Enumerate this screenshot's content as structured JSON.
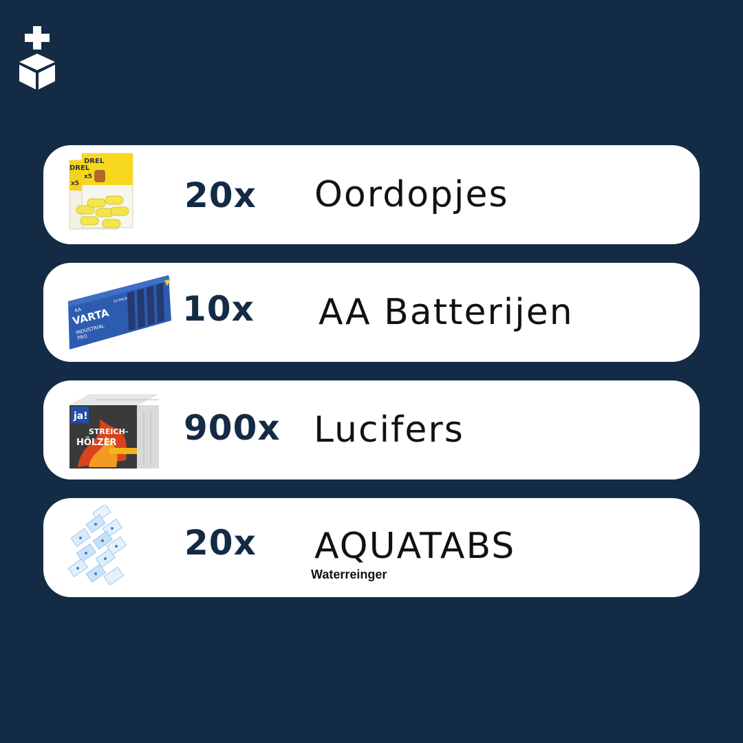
{
  "brand": {
    "logo_icon": "plus-box-icon"
  },
  "items": [
    {
      "quantity": "20x",
      "name": "Oordopjes",
      "image_icon": "earplugs-package-icon",
      "package_text": [
        "DREL",
        "x5",
        "x5"
      ]
    },
    {
      "quantity": "10x",
      "name": "AA Batterijen",
      "image_icon": "varta-batteries-box-icon",
      "package_text": [
        "AA",
        "VARTA",
        "INDUSTRIAL",
        "PRO",
        "10 PACK"
      ]
    },
    {
      "quantity": "900x",
      "name": "Lucifers",
      "image_icon": "matchboxes-icon",
      "package_text": [
        "ja!",
        "STREICH-",
        "HÖLZER"
      ]
    },
    {
      "quantity": "20x",
      "name": "AQUATABS",
      "subtitle": "Waterreinger",
      "image_icon": "aquatabs-sachets-icon"
    }
  ],
  "colors": {
    "background": "#142b45",
    "card": "#ffffff",
    "quantity_text": "#142b45"
  }
}
